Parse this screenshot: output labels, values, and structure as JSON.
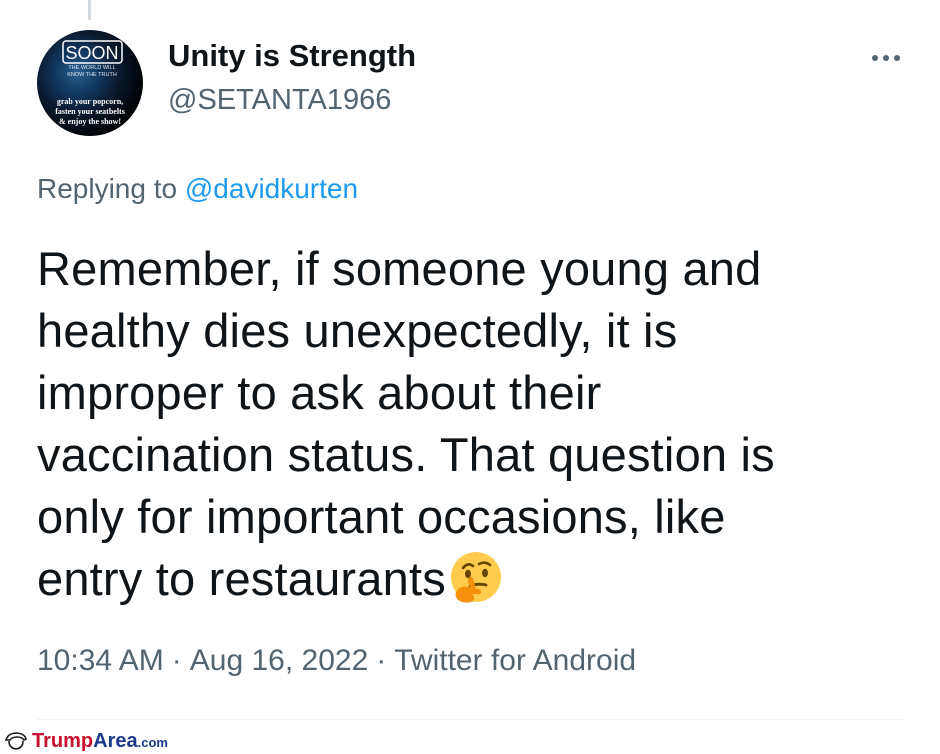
{
  "tweet": {
    "display_name": "Unity is Strength",
    "handle": "@SETANTA1966",
    "replying_prefix": "Replying to",
    "replying_to": "@davidkurten",
    "text_lines": [
      "Remember, if someone young and",
      "healthy dies unexpectedly, it is",
      "improper to ask about their",
      "vaccination status. That question is",
      "only for important occasions, like",
      "entry to restaurants"
    ],
    "emoji": "thinking-face",
    "time": "10:34 AM",
    "date": "Aug 16, 2022",
    "source": "Twitter for Android",
    "separator": "·"
  },
  "avatar": {
    "soon": "SOON",
    "sub1": "THE WORLD WILL",
    "sub2": "KNOW THE TRUTH",
    "line1": "grab your popcorn,",
    "line2": "fasten your seatbelts",
    "line3": "& enjoy the show!"
  },
  "watermark": {
    "brand_a": "Trump",
    "brand_b": "Area",
    "suffix": ".com",
    "color_a": "#c8102e",
    "color_b": "#1a3a8c"
  },
  "colors": {
    "text": "#0f1419",
    "secondary": "#536471",
    "link": "#1d9bf0"
  }
}
